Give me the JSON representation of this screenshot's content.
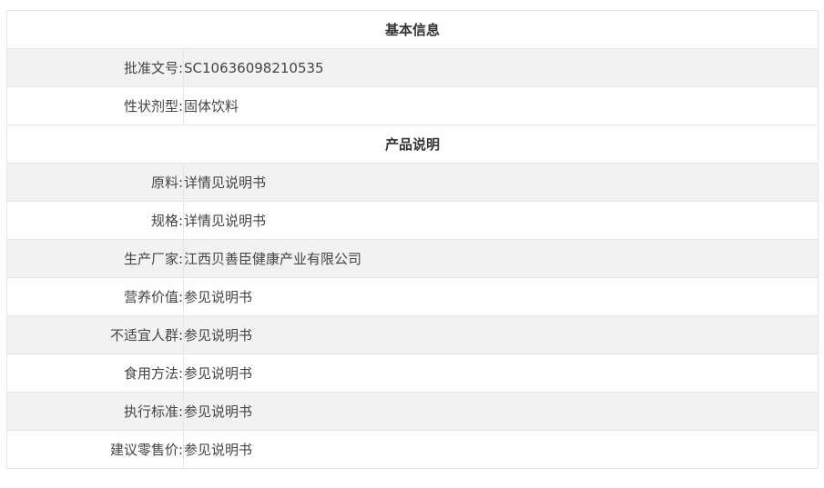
{
  "basic": {
    "title": "基本信息",
    "rows": [
      {
        "label": "批准文号:",
        "value": "SC10636098210535"
      },
      {
        "label": "性状剂型:",
        "value": "固体饮料"
      }
    ]
  },
  "product": {
    "title": "产品说明",
    "rows": [
      {
        "label": "原料:",
        "value": "详情见说明书"
      },
      {
        "label": "规格:",
        "value": "详情见说明书"
      },
      {
        "label": "生产厂家:",
        "value": "江西贝善臣健康产业有限公司"
      },
      {
        "label": "营养价值:",
        "value": "参见说明书"
      },
      {
        "label": "不适宜人群:",
        "value": "参见说明书"
      },
      {
        "label": "食用方法:",
        "value": "参见说明书"
      },
      {
        "label": "执行标准:",
        "value": "参见说明书"
      },
      {
        "label": "建议零售价:",
        "value": "参见说明书"
      }
    ]
  }
}
